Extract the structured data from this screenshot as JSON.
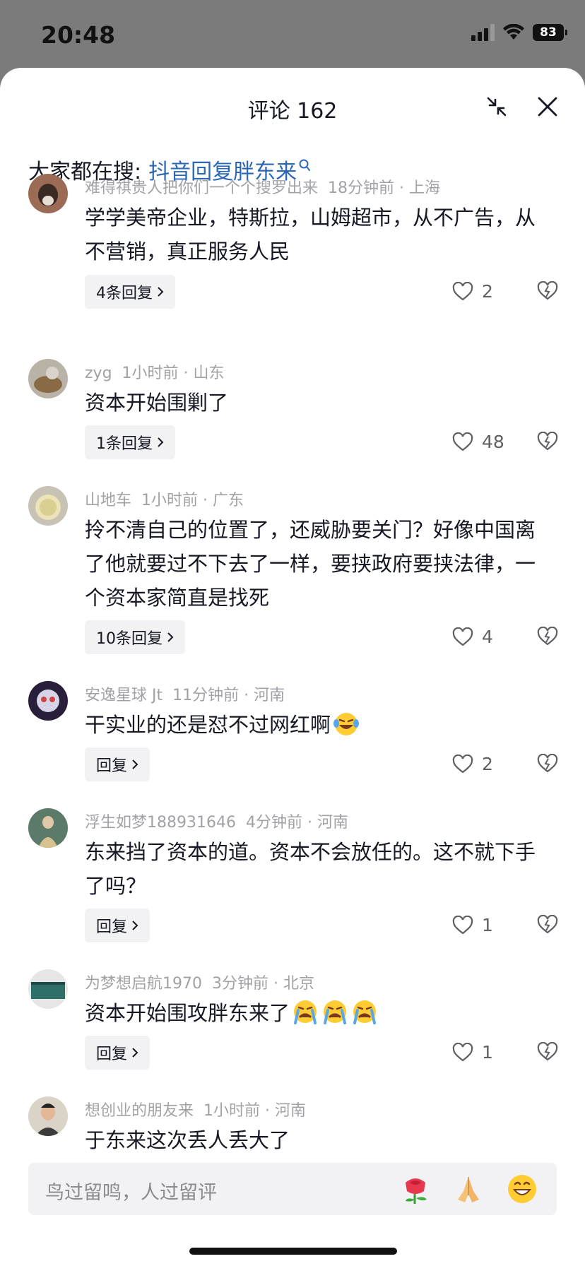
{
  "status": {
    "time": "20:48",
    "battery": "83"
  },
  "header": {
    "title": "评论 162"
  },
  "search_hint": {
    "prefix": "大家都在搜:",
    "link": "抖音回复胖东来"
  },
  "comments": [
    {
      "user": "难得祺贵人把你们一个个搜罗出来",
      "time": "18分钟前 · 上海",
      "text": "学学美帝企业，特斯拉，山姆超市，从不广告，从不营销，真正服务人民",
      "reply_label": "4条回复",
      "likes": "2",
      "avatar_color": "#9b6b55"
    },
    {
      "user": "zyg",
      "time": "1小时前 · 山东",
      "text": "资本开始围剿了",
      "reply_label": "1条回复",
      "likes": "48",
      "avatar_color": "#b9b2a6"
    },
    {
      "user": "山地车",
      "time": "1小时前 · 广东",
      "text": "拎不清自己的位置了，还威胁要关门？好像中国离了他就要过不下去了一样，要挟政府要挟法律，一个资本家简直是找死",
      "reply_label": "10条回复",
      "likes": "4",
      "avatar_color": "#d9cfa0"
    },
    {
      "user": "安逸星球 Jt",
      "time": "11分钟前 · 河南",
      "text": "干实业的还是怼不过网红啊",
      "reply_label": "回复",
      "likes": "2",
      "avatar_color": "#3a2a55",
      "emoji": "laugh-cry-emoji"
    },
    {
      "user": "浮生如梦188931646",
      "time": "4分钟前 · 河南",
      "text": "东来挡了资本的道。资本不会放任的。这不就下手了吗？",
      "reply_label": "回复",
      "likes": "1",
      "avatar_color": "#5c7a6a"
    },
    {
      "user": "为梦想启航1970",
      "time": "3分钟前 · 北京",
      "text": "资本开始围攻胖东来了",
      "reply_label": "回复",
      "likes": "1",
      "avatar_color": "#2f6f6a",
      "emoji": "crying-emoji"
    },
    {
      "user": "想创业的朋友来",
      "time": "1小时前 · 河南",
      "text": "于东来这次丢人丢大了",
      "avatar_color": "#3b3b3b"
    }
  ],
  "input": {
    "placeholder": "鸟过留鸣，人过留评"
  },
  "quick_emojis": [
    "rose-emoji",
    "pray-emoji",
    "grin-emoji"
  ]
}
